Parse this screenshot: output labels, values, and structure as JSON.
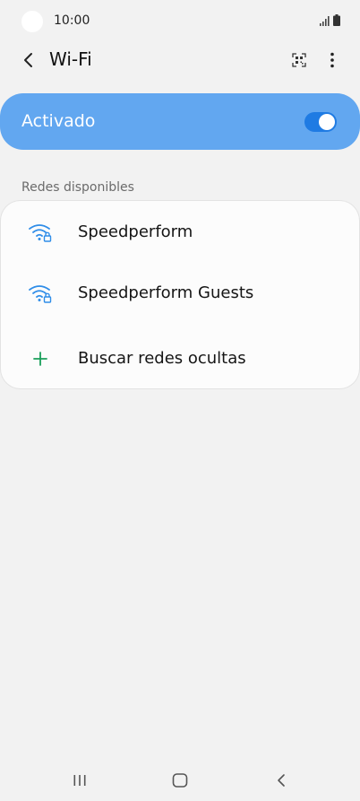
{
  "status_bar": {
    "time": "10:00"
  },
  "toolbar": {
    "title": "Wi-Fi"
  },
  "master_switch": {
    "label": "Activado",
    "state": "on"
  },
  "networks_section": {
    "header": "Redes disponibles",
    "items": [
      {
        "label": "Speedperform",
        "icon": "wifi-lock-icon"
      },
      {
        "label": "Speedperform Guests",
        "icon": "wifi-lock-icon"
      },
      {
        "label": "Buscar redes ocultas",
        "icon": "plus-icon"
      }
    ]
  },
  "colors": {
    "accent": "#1f7be3",
    "banner": "#62a7f0",
    "wifi_icon": "#2f8de8",
    "plus_icon": "#1a9e5a",
    "background": "#f2f2f2"
  }
}
